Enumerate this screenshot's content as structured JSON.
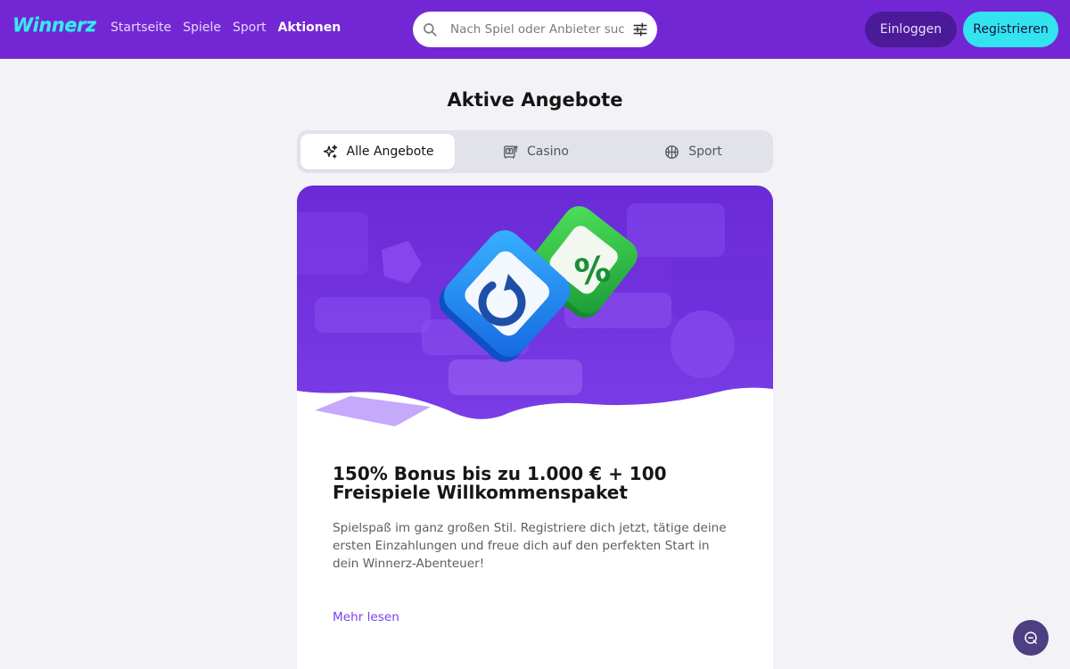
{
  "brand": {
    "logo_text": "Winnerz",
    "primary_color": "#7327d4",
    "accent_color": "#33e3f0"
  },
  "header": {
    "nav": [
      {
        "label": "Startseite",
        "active": false
      },
      {
        "label": "Spiele",
        "active": false
      },
      {
        "label": "Sport",
        "active": false
      },
      {
        "label": "Aktionen",
        "active": true
      }
    ],
    "search": {
      "placeholder": "Nach Spiel oder Anbieter suchen",
      "value": "",
      "icon": "search-icon",
      "filter_icon": "sliders-icon"
    },
    "login_label": "Einloggen",
    "register_label": "Registrieren"
  },
  "main": {
    "title": "Aktive Angebote",
    "tabs": [
      {
        "label": "Alle Angebote",
        "icon": "sparkles-icon",
        "active": true
      },
      {
        "label": "Casino",
        "icon": "slot-machine-icon",
        "active": false
      },
      {
        "label": "Sport",
        "icon": "basketball-icon",
        "active": false
      }
    ],
    "offer": {
      "title": "150% Bonus bis zu 1.000 € + 100 Freispiele Willkommenspaket",
      "description": "Spielspaß im ganz großen Stil. Registriere dich jetzt, tätige deine ersten Einzahlungen und freue dich auf den perfekten Start in dein Winnerz-Abenteuer!",
      "link_label": "Mehr lesen"
    }
  },
  "chat": {
    "icon": "chat-icon"
  }
}
